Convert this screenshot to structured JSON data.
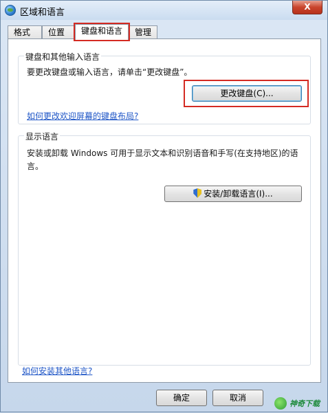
{
  "window": {
    "title": "区域和语言",
    "close_label": "X"
  },
  "tabs": [
    {
      "label": "格式"
    },
    {
      "label": "位置"
    },
    {
      "label": "键盘和语言"
    },
    {
      "label": "管理"
    }
  ],
  "keyboard_group": {
    "title": "键盘和其他输入语言",
    "description": "要更改键盘或输入语言，请单击“更改键盘”。",
    "change_keyboard_button": "更改键盘(C)...",
    "welcome_layout_link": "如何更改欢迎屏幕的键盘布局?"
  },
  "display_group": {
    "title": "显示语言",
    "description": "安装或卸载 Windows 可用于显示文本和识别语音和手写(在支持地区)的语言。",
    "install_button": "安装/卸载语言(I)..."
  },
  "install_other_link": "如何安装其他语言?",
  "buttons": {
    "ok": "确定",
    "cancel": "取消"
  },
  "watermark": {
    "text": "神奇下载"
  },
  "icons": {
    "title": "globe-icon",
    "shield": "uac-shield-icon",
    "watermark": "watermark-logo-icon"
  },
  "colors": {
    "highlight_box": "#d42a22",
    "link": "#1f56c7"
  }
}
